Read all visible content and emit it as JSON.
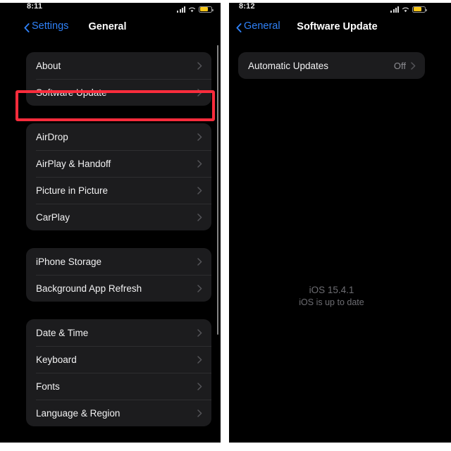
{
  "left_phone": {
    "status_bar": {
      "time": "8:11",
      "signal_icon": "cellular-signal-icon",
      "wifi_icon": "wifi-icon",
      "battery_icon": "battery-low-power-icon"
    },
    "nav": {
      "back_label": "Settings",
      "back_icon": "chevron-left-icon",
      "title": "General"
    },
    "groups": [
      {
        "rows": [
          {
            "label": "About",
            "value": "",
            "chevron": "chevron-right-icon"
          },
          {
            "label": "Software Update",
            "value": "",
            "chevron": "chevron-right-icon"
          }
        ]
      },
      {
        "rows": [
          {
            "label": "AirDrop",
            "value": "",
            "chevron": "chevron-right-icon"
          },
          {
            "label": "AirPlay & Handoff",
            "value": "",
            "chevron": "chevron-right-icon"
          },
          {
            "label": "Picture in Picture",
            "value": "",
            "chevron": "chevron-right-icon"
          },
          {
            "label": "CarPlay",
            "value": "",
            "chevron": "chevron-right-icon"
          }
        ]
      },
      {
        "rows": [
          {
            "label": "iPhone Storage",
            "value": "",
            "chevron": "chevron-right-icon"
          },
          {
            "label": "Background App Refresh",
            "value": "",
            "chevron": "chevron-right-icon"
          }
        ]
      },
      {
        "rows": [
          {
            "label": "Date & Time",
            "value": "",
            "chevron": "chevron-right-icon"
          },
          {
            "label": "Keyboard",
            "value": "",
            "chevron": "chevron-right-icon"
          },
          {
            "label": "Fonts",
            "value": "",
            "chevron": "chevron-right-icon"
          },
          {
            "label": "Language & Region",
            "value": "",
            "chevron": "chevron-right-icon"
          }
        ]
      }
    ]
  },
  "right_phone": {
    "status_bar": {
      "time": "8:12",
      "signal_icon": "cellular-signal-icon",
      "wifi_icon": "wifi-icon",
      "battery_icon": "battery-low-power-icon"
    },
    "nav": {
      "back_label": "General",
      "back_icon": "chevron-left-icon",
      "title": "Software Update"
    },
    "groups": [
      {
        "rows": [
          {
            "label": "Automatic Updates",
            "value": "Off",
            "chevron": "chevron-right-icon"
          }
        ]
      }
    ],
    "update_status": {
      "version": "iOS 15.4.1",
      "message": "iOS is up to date"
    }
  },
  "annotation": {
    "highlight_target": "Software Update",
    "highlight_color": "#fb2c3c"
  },
  "colors": {
    "background": "#000000",
    "page_background": "#ffffff",
    "row_background": "#1c1c1e",
    "separator": "#2e2e30",
    "primary_text": "#f2f2f3",
    "secondary_text": "#8e8e93",
    "tint_blue": "#2f81f7",
    "battery_yellow": "#f5c518"
  }
}
